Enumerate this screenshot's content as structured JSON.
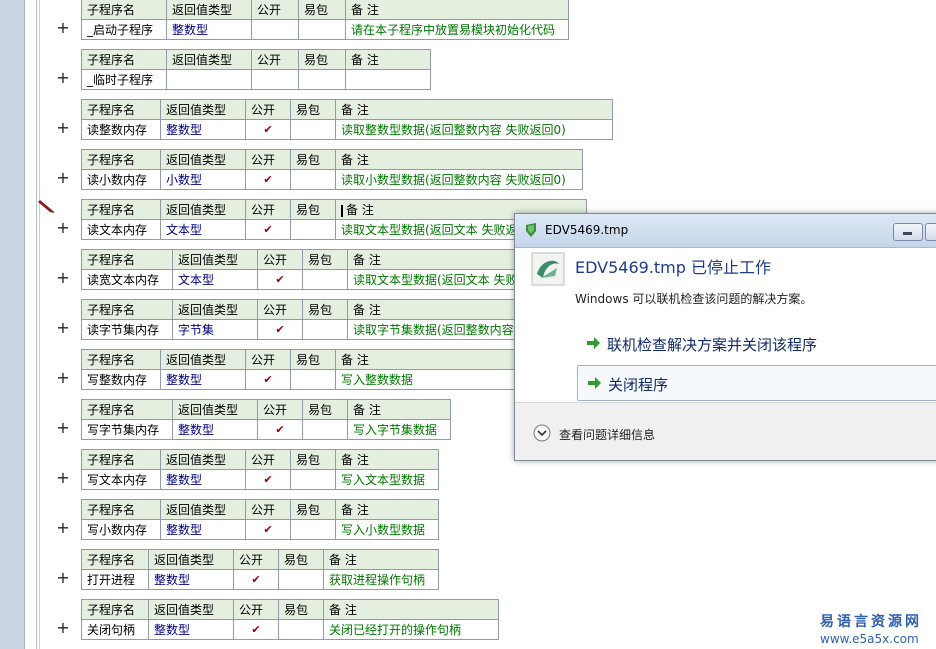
{
  "headers": {
    "name": "子程序名",
    "rettype": "返回值类型",
    "public": "公开",
    "easypkg": "易包",
    "note": "备 注"
  },
  "plus_symbol": "+",
  "check_symbol": "✔",
  "subroutines": [
    {
      "name": "_启动子程序",
      "rettype": "整数型",
      "public": false,
      "note": "请在本子程序中放置易模块初始化代码"
    },
    {
      "name": "_临时子程序",
      "rettype": "",
      "public": false,
      "note": ""
    },
    {
      "name": "读整数内存",
      "rettype": "整数型",
      "public": true,
      "note": "读取整数型数据(返回整数内容 失败返回0)"
    },
    {
      "name": "读小数内存",
      "rettype": "小数型",
      "public": true,
      "note": "读取小数型数据(返回整数内容 失败返回0)"
    },
    {
      "name": "读文本内存",
      "rettype": "文本型",
      "public": true,
      "note": "读取文本型数据(返回文本 失败返回空文"
    },
    {
      "name": "读宽文本内存",
      "rettype": "文本型",
      "public": true,
      "note": "读取文本型数据(返回文本 失败返回空"
    },
    {
      "name": "读字节集内存",
      "rettype": "字节集",
      "public": true,
      "note": "读取字节集数据(返回整数内容 失败返"
    },
    {
      "name": "写整数内存",
      "rettype": "整数型",
      "public": true,
      "note": "写入整数数据"
    },
    {
      "name": "写字节集内存",
      "rettype": "整数型",
      "public": true,
      "note": "写入字节集数据"
    },
    {
      "name": "写文本内存",
      "rettype": "整数型",
      "public": true,
      "note": "写入文本型数据"
    },
    {
      "name": "写小数内存",
      "rettype": "整数型",
      "public": true,
      "note": "写入小数型数据"
    },
    {
      "name": "打开进程",
      "rettype": "整数型",
      "public": true,
      "note": "获取进程操作句柄"
    },
    {
      "name": "关闭句柄",
      "rettype": "整数型",
      "public": true,
      "note": "关闭已经打开的操作句柄"
    }
  ],
  "dialog": {
    "title": "EDV5469.tmp",
    "heading": "EDV5469.tmp 已停止工作",
    "description": "Windows 可以联机检查该问题的解决方案。",
    "option_online": "联机检查解决方案并关闭该程序",
    "option_close": "关闭程序",
    "details": "查看问题详细信息"
  },
  "watermark": {
    "name": "易语言资源网",
    "url": "www.e5a5x.com"
  },
  "colors": {
    "header_bg": "#e4efe0",
    "type_text": "#000080",
    "note_text": "#007800",
    "check": "#a00000",
    "dialog_heading": "#1e3b8c"
  }
}
